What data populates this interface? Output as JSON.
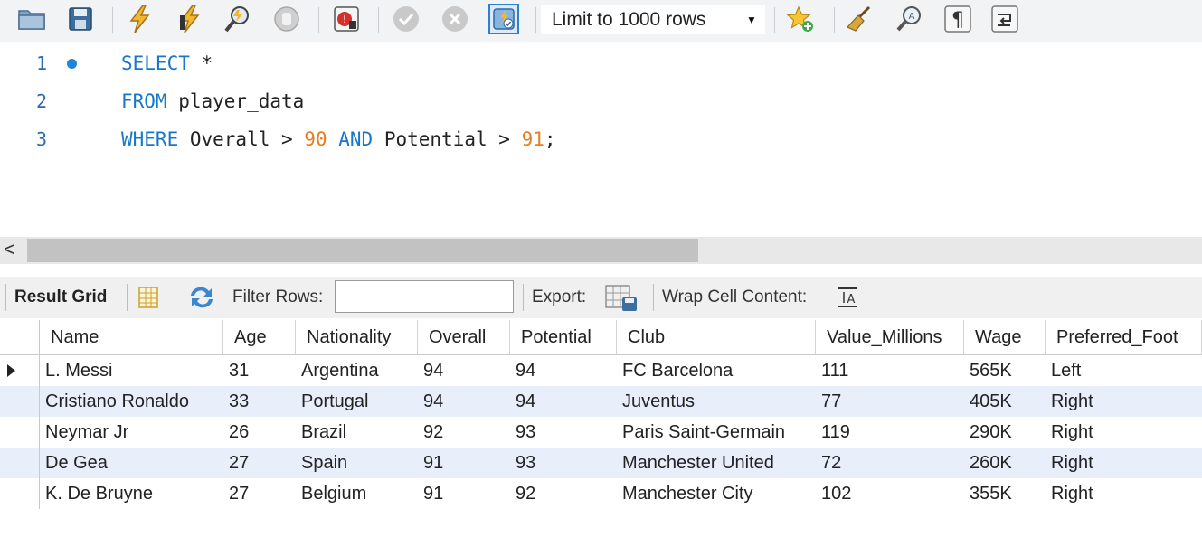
{
  "toolbar": {
    "limit_label": "Limit to 1000 rows",
    "icons": [
      "open-folder-icon",
      "save-icon",
      "execute-icon",
      "execute-current-icon",
      "explain-icon",
      "stop-icon",
      "toggle-error-icon",
      "commit-icon",
      "rollback-icon",
      "autocommit-icon",
      "add-snippet-icon",
      "beautify-icon",
      "find-icon",
      "invisible-chars-icon",
      "wrap-icon"
    ]
  },
  "editor": {
    "lines": [
      {
        "num": "1",
        "tokens": [
          {
            "t": "SELECT",
            "c": "kw"
          },
          {
            "t": " *",
            "c": ""
          }
        ]
      },
      {
        "num": "2",
        "tokens": [
          {
            "t": "FROM",
            "c": "kw"
          },
          {
            "t": " player_data",
            "c": ""
          }
        ]
      },
      {
        "num": "3",
        "tokens": [
          {
            "t": "WHERE",
            "c": "kw"
          },
          {
            "t": " Overall > ",
            "c": ""
          },
          {
            "t": "90",
            "c": "num"
          },
          {
            "t": " ",
            "c": ""
          },
          {
            "t": "AND",
            "c": "kw"
          },
          {
            "t": " Potential > ",
            "c": ""
          },
          {
            "t": "91",
            "c": "num"
          },
          {
            "t": ";",
            "c": ""
          }
        ]
      }
    ]
  },
  "scrollbar": {
    "left_arrow": "<"
  },
  "result_toolbar": {
    "result_grid_label": "Result Grid",
    "filter_label": "Filter Rows:",
    "filter_value": "",
    "export_label": "Export:",
    "wrap_label": "Wrap Cell Content:"
  },
  "grid": {
    "columns": [
      "Name",
      "Age",
      "Nationality",
      "Overall",
      "Potential",
      "Club",
      "Value_Millions",
      "Wage",
      "Preferred_Foot"
    ],
    "rows": [
      [
        "L. Messi",
        "31",
        "Argentina",
        "94",
        "94",
        "FC Barcelona",
        "111",
        "565K",
        "Left"
      ],
      [
        "Cristiano Ronaldo",
        "33",
        "Portugal",
        "94",
        "94",
        "Juventus",
        "77",
        "405K",
        "Right"
      ],
      [
        "Neymar Jr",
        "26",
        "Brazil",
        "92",
        "93",
        "Paris Saint-Germain",
        "119",
        "290K",
        "Right"
      ],
      [
        "De Gea",
        "27",
        "Spain",
        "91",
        "93",
        "Manchester United",
        "72",
        "260K",
        "Right"
      ],
      [
        "K. De Bruyne",
        "27",
        "Belgium",
        "91",
        "92",
        "Manchester City",
        "102",
        "355K",
        "Right"
      ]
    ],
    "selected_row": 0
  },
  "colors": {
    "keyword": "#1877c9",
    "number": "#e87d1e",
    "line_number": "#2a6ab0",
    "alt_row": "#e9eefb"
  }
}
